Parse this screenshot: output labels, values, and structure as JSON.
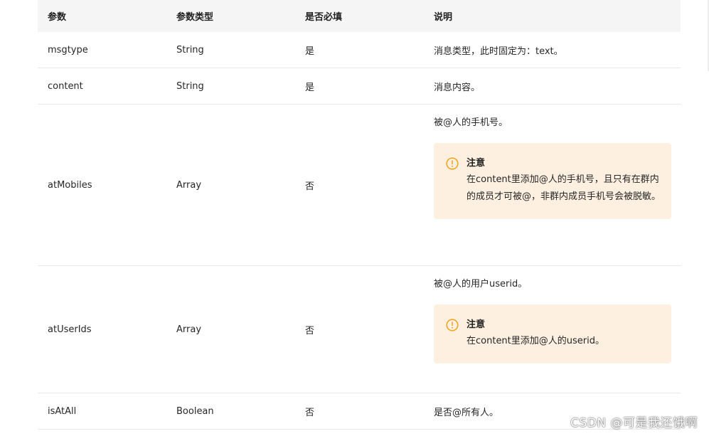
{
  "table": {
    "headers": [
      "参数",
      "参数类型",
      "是否必填",
      "说明"
    ],
    "rows": [
      {
        "param": "msgtype",
        "type": "String",
        "required": "是",
        "desc": "消息类型，此时固定为：text。"
      },
      {
        "param": "content",
        "type": "String",
        "required": "是",
        "desc": "消息内容。"
      },
      {
        "param": "atMobiles",
        "type": "Array",
        "required": "否",
        "desc": "被@人的手机号。",
        "notice": {
          "icon": "exclamation-circle-icon",
          "title": "注意",
          "text": "在content里添加@人的手机号，且只有在群内的成员才可被@，非群内成员手机号会被脱敏。"
        }
      },
      {
        "param": "atUserIds",
        "type": "Array",
        "required": "否",
        "desc": "被@人的用户userid。",
        "notice": {
          "icon": "exclamation-circle-icon",
          "title": "注意",
          "text": "在content里添加@人的userid。"
        }
      },
      {
        "param": "isAtAll",
        "type": "Boolean",
        "required": "否",
        "desc": "是否@所有人。"
      }
    ]
  },
  "watermark": "CSDN @可是我还饿啊",
  "colors": {
    "header_bg": "#f5f5f5",
    "notice_bg": "#fdf0e0",
    "notice_icon": "#f5a623",
    "border": "#e8e8e8"
  }
}
